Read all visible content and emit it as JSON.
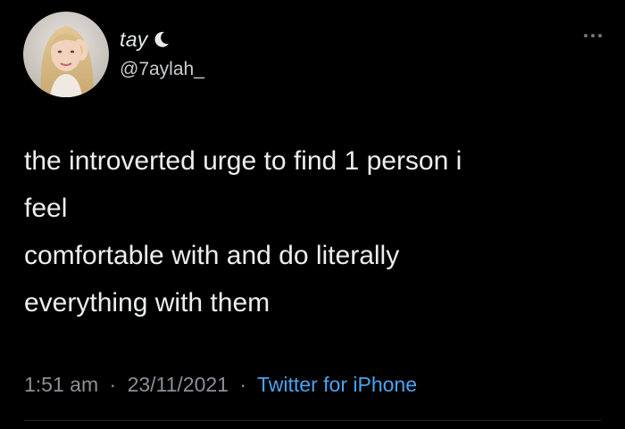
{
  "profile": {
    "display_name": "tay",
    "handle": "@7aylah_",
    "avatar_icon": "profile-photo",
    "status_icon": "moon-icon"
  },
  "tweet": {
    "lines": [
      "the introverted urge to find 1 person i",
      "feel",
      "comfortable with and do literally",
      "everything with them"
    ],
    "time": "1:51 am",
    "date": "23/11/2021",
    "separator": "·",
    "source": "Twitter for iPhone"
  },
  "colors": {
    "background": "#000000",
    "text": "#e7e9ea",
    "muted": "#8b9096",
    "link": "#4aa3ef"
  }
}
